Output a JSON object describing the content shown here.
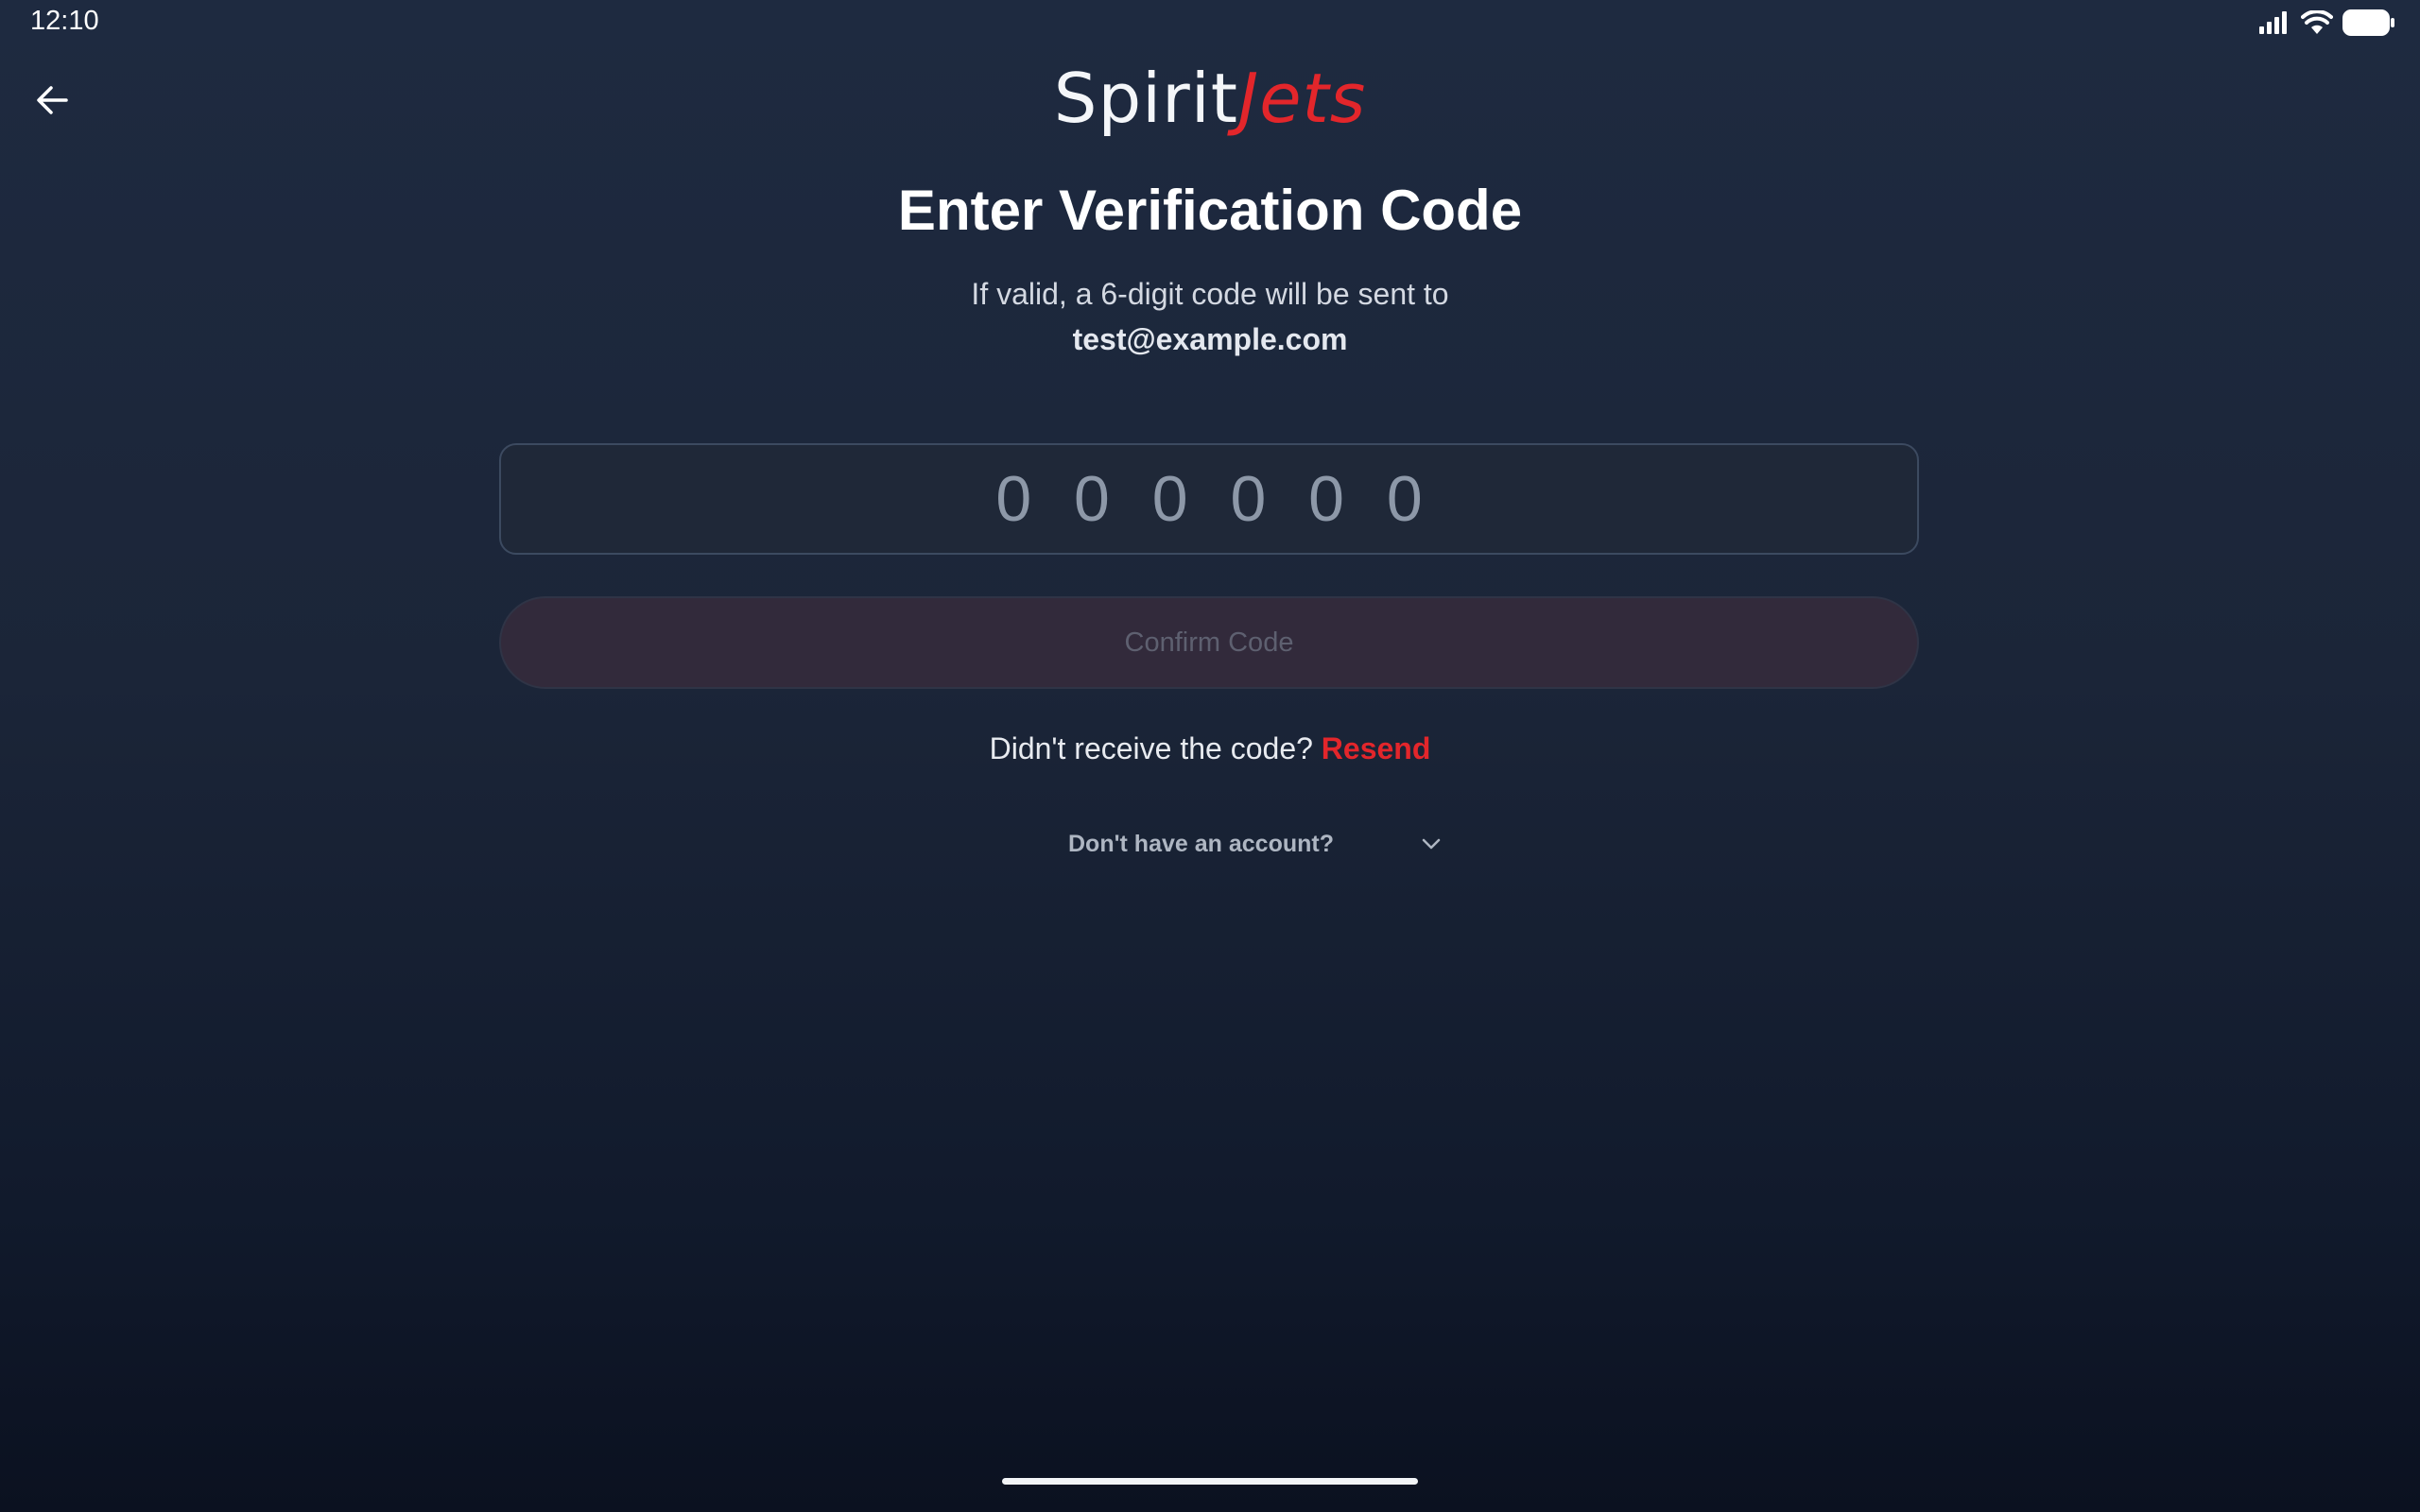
{
  "status_bar": {
    "time": "12:10",
    "icons": [
      "signal-icon",
      "wifi-icon",
      "battery-icon"
    ]
  },
  "header": {
    "back_icon": "arrow-left-icon",
    "logo_part1": "Spirit",
    "logo_part2": "Jets"
  },
  "main": {
    "title": "Enter Verification Code",
    "subtitle": "If valid, a 6-digit code will be sent to",
    "email": "test@example.com",
    "code_placeholder": "0 0 0 0 0 0",
    "code_value": "",
    "confirm_label": "Confirm Code",
    "resend_prompt": "Didn't receive the code?",
    "resend_label": "Resend",
    "account_prompt": "Don't have an account?"
  },
  "colors": {
    "brand_red": "#e3262b",
    "background_top": "#1e2a40",
    "background_bottom": "#0b1120",
    "disabled_button": "#322a3b"
  }
}
